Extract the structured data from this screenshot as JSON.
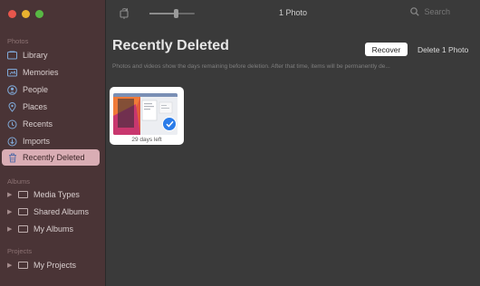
{
  "window": {
    "title": "1 Photo"
  },
  "toolbar": {
    "search_placeholder": "Search"
  },
  "sidebar": {
    "photos_section": "Photos",
    "photos_items": [
      {
        "label": "Library",
        "icon": "library-icon"
      },
      {
        "label": "Memories",
        "icon": "memories-icon"
      },
      {
        "label": "People",
        "icon": "people-icon"
      },
      {
        "label": "Places",
        "icon": "places-icon"
      },
      {
        "label": "Recents",
        "icon": "recents-icon"
      },
      {
        "label": "Imports",
        "icon": "imports-icon"
      },
      {
        "label": "Recently Deleted",
        "icon": "trash-icon",
        "selected": true
      }
    ],
    "albums_section": "Albums",
    "album_items": [
      {
        "label": "Media Types",
        "icon": "folder-icon"
      },
      {
        "label": "Shared Albums",
        "icon": "folder-icon"
      },
      {
        "label": "My Albums",
        "icon": "folder-icon"
      }
    ],
    "projects_section": "Projects",
    "project_items": [
      {
        "label": "My Projects",
        "icon": "folder-icon"
      }
    ]
  },
  "main": {
    "title": "Recently Deleted",
    "recover_label": "Recover",
    "delete_label": "Delete 1 Photo",
    "description": "Photos and videos show the days remaining before deletion. After that time, items will be permanently de...",
    "photos": [
      {
        "days_left": "29 days left",
        "selected": true
      }
    ]
  },
  "colors": {
    "accent": "#2b7ce9",
    "sidebar_bg": "#4a3436",
    "selected_bg": "#d9adb4",
    "content_bg": "#3a3a3a"
  }
}
